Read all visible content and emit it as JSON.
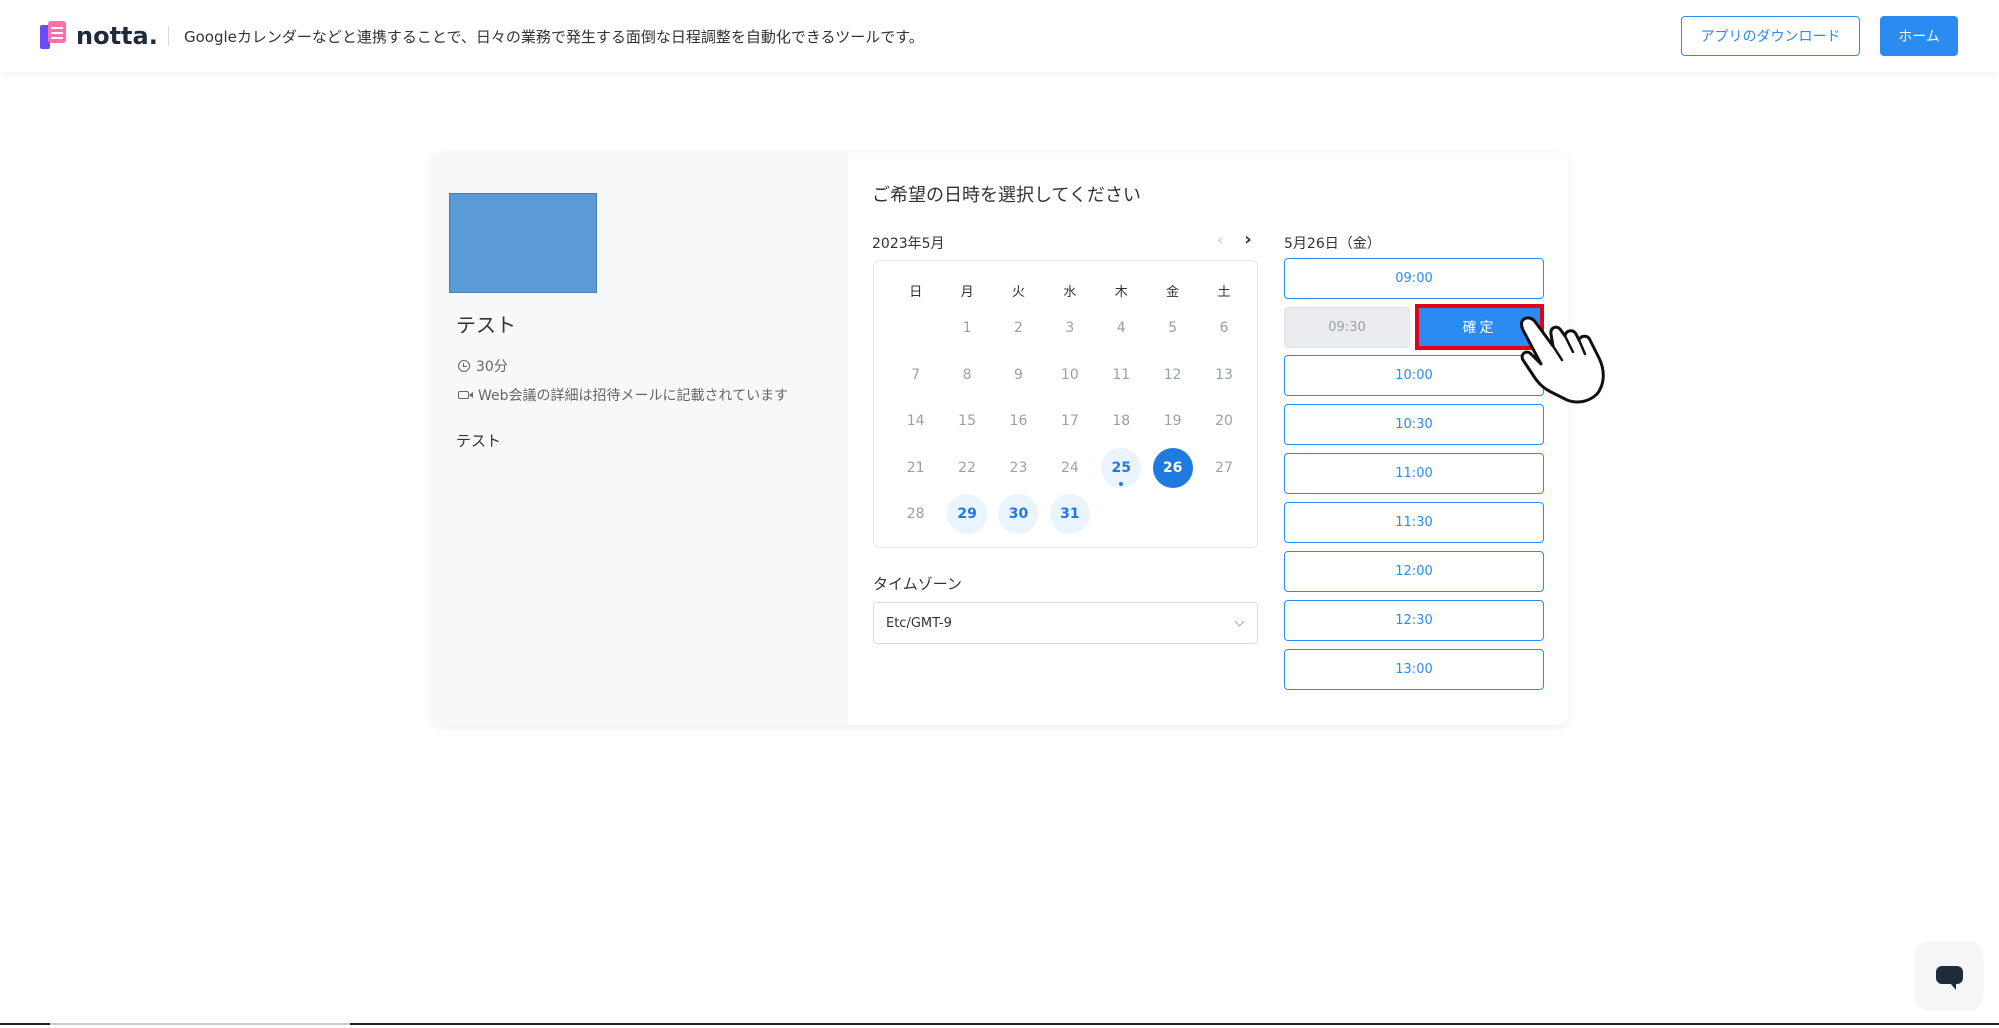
{
  "header": {
    "logo_text": "notta.",
    "tagline": "Googleカレンダーなどと連携することで、日々の業務で発生する面倒な日程調整を自動化できるツールです。",
    "download_label": "アプリのダウンロード",
    "home_label": "ホーム"
  },
  "event": {
    "title": "テスト",
    "duration": "30分",
    "meeting_note": "Web会議の詳細は招待メールに記載されています",
    "description": "テスト"
  },
  "scheduler": {
    "prompt": "ご希望の日時を選択してください",
    "month_label": "2023年5月",
    "prev_glyph": "‹",
    "next_glyph": "›",
    "weekdays": [
      "日",
      "月",
      "火",
      "水",
      "木",
      "金",
      "土"
    ],
    "days": [
      {
        "label": "",
        "state": "empty"
      },
      {
        "label": "1",
        "state": "disabled"
      },
      {
        "label": "2",
        "state": "disabled"
      },
      {
        "label": "3",
        "state": "disabled"
      },
      {
        "label": "4",
        "state": "disabled"
      },
      {
        "label": "5",
        "state": "disabled"
      },
      {
        "label": "6",
        "state": "disabled"
      },
      {
        "label": "7",
        "state": "disabled"
      },
      {
        "label": "8",
        "state": "disabled"
      },
      {
        "label": "9",
        "state": "disabled"
      },
      {
        "label": "10",
        "state": "disabled"
      },
      {
        "label": "11",
        "state": "disabled"
      },
      {
        "label": "12",
        "state": "disabled"
      },
      {
        "label": "13",
        "state": "disabled"
      },
      {
        "label": "14",
        "state": "disabled"
      },
      {
        "label": "15",
        "state": "disabled"
      },
      {
        "label": "16",
        "state": "disabled"
      },
      {
        "label": "17",
        "state": "disabled"
      },
      {
        "label": "18",
        "state": "disabled"
      },
      {
        "label": "19",
        "state": "disabled"
      },
      {
        "label": "20",
        "state": "disabled"
      },
      {
        "label": "21",
        "state": "disabled"
      },
      {
        "label": "22",
        "state": "disabled"
      },
      {
        "label": "23",
        "state": "disabled"
      },
      {
        "label": "24",
        "state": "disabled"
      },
      {
        "label": "25",
        "state": "today"
      },
      {
        "label": "26",
        "state": "selected"
      },
      {
        "label": "27",
        "state": "disabled"
      },
      {
        "label": "28",
        "state": "disabled"
      },
      {
        "label": "29",
        "state": "avail"
      },
      {
        "label": "30",
        "state": "avail"
      },
      {
        "label": "31",
        "state": "avail"
      }
    ],
    "timezone_label": "タイムゾーン",
    "timezone_value": "Etc/GMT-9",
    "selected_date": "5月26日（金）",
    "first_slot": "09:00",
    "selected_slot": "09:30",
    "confirm_label": "確定",
    "slots": [
      "10:00",
      "10:30",
      "11:00",
      "11:30",
      "12:00",
      "12:30",
      "13:00"
    ]
  },
  "colors": {
    "accent": "#2b8bf0",
    "highlight": "#e3001b"
  }
}
